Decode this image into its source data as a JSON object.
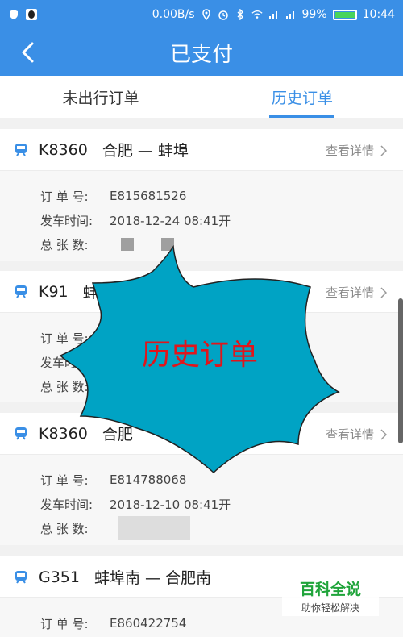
{
  "statusbar": {
    "speed": "0.00B/s",
    "battery": "99%",
    "time": "10:44"
  },
  "header": {
    "title": "已支付"
  },
  "tabs": [
    {
      "label": "未出行订单",
      "active": false
    },
    {
      "label": "历史订单",
      "active": true
    }
  ],
  "labels": {
    "order_no": "订 单 号:",
    "depart_time": "发车时间:",
    "total": "总 张 数:",
    "detail": "查看详情"
  },
  "orders": [
    {
      "train": "K8360",
      "route": "合肥 — 蚌埠",
      "order_no": "E815681526",
      "depart": "2018-12-24  08:41开"
    },
    {
      "train": "K91",
      "route": "蚌埠",
      "order_no": "",
      "depart": ""
    },
    {
      "train": "K8360",
      "route": "合肥",
      "order_no": "E814788068",
      "depart": "2018-12-10  08:41开"
    },
    {
      "train": "G351",
      "route": "蚌埠南 — 合肥南",
      "order_no": "E860422754",
      "depart": ""
    }
  ],
  "overlay": {
    "text": "历史订单",
    "fill": "#00a3c4",
    "text_color": "#e0151b"
  },
  "watermark": {
    "title": "百科全说",
    "subtitle": "助你轻松解决"
  }
}
